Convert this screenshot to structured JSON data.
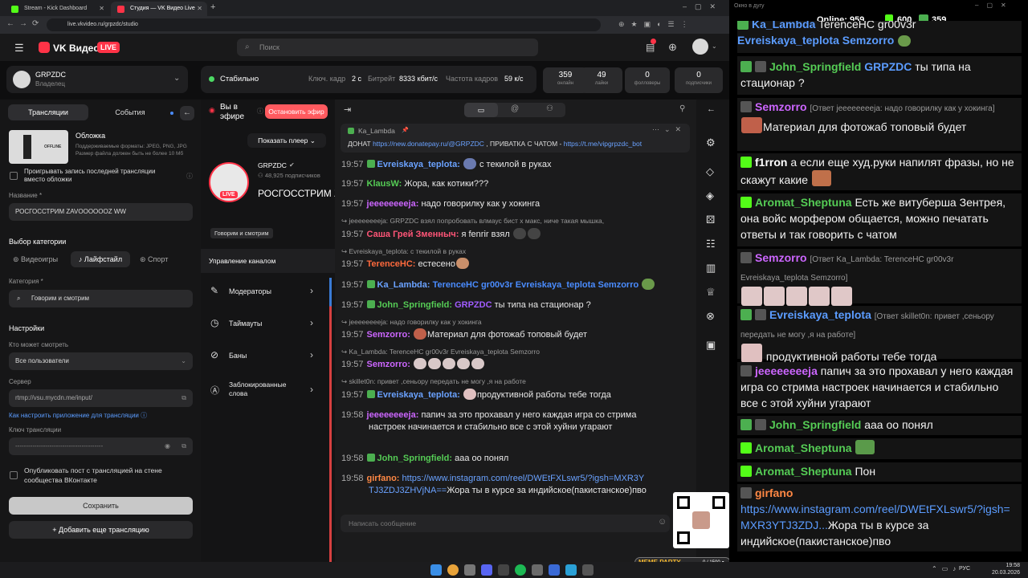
{
  "browser": {
    "tabs": [
      {
        "label": "Stream - Kick Dashboard",
        "color": "#53fc18"
      },
      {
        "label": "Студия — VK Видео Live",
        "color": "#ff3347"
      }
    ],
    "new_tab": "+",
    "url": "live.vkvideo.ru/grpzdc/studio"
  },
  "vk": {
    "logo": "VK Видео",
    "live_badge": "LIVE",
    "search_placeholder": "Поиск",
    "channel": {
      "name": "GRPZDC",
      "role": "Владелец"
    },
    "status": {
      "label": "Стабильно",
      "keyframe_label": "Ключ. кадр",
      "keyframe_value": "2 с",
      "bitrate_label": "Битрейт",
      "bitrate_value": "8333 кбит/с",
      "fps_label": "Частота кадров",
      "fps_value": "59 к/с"
    },
    "stats": [
      {
        "n": "359",
        "l": "онлайн"
      },
      {
        "n": "49",
        "l": "лайки"
      },
      {
        "n": "0",
        "l": "фолловеры"
      },
      {
        "n": "0",
        "l": "подписчики"
      }
    ],
    "left_tabs": [
      "Трансляции",
      "События"
    ],
    "cover": {
      "title": "Обложка",
      "desc": "Поддерживаемые форматы: JPEG, PNG, JPG Размер файла должен быть не более 10 Мб",
      "thumb_label": "OFFLINE"
    },
    "play_last": "Проигрывать запись последней трансляции вместо обложки",
    "name_label": "Название *",
    "name_value": "РОСГОССТРИМ ZAVOOOOOOZ WW",
    "category_label": "Выбор категории",
    "category_tabs": [
      "Видеоигры",
      "Лайфстайл",
      "Спорт"
    ],
    "cat_field_label": "Категория *",
    "cat_field_value": "Говорим и смотрим",
    "settings": "Настройки",
    "who_label": "Кто может смотреть",
    "who_value": "Все пользователи",
    "server_label": "Сервер",
    "server_value": "rtmp://vsu.mycdn.me/input/",
    "howto": "Как настроить приложение для трансляции",
    "key_label": "Ключ трансляции",
    "key_value": "-----------------------------------------",
    "publish": "Опубликовать пост с трансляцией на стене сообщества ВКонтакте",
    "save": "Сохранить",
    "add": "Добавить еще трансляцию",
    "onair": "Вы в эфире",
    "stop": "Остановить эфир",
    "show_player": "Показать плеер",
    "streamer": {
      "name": "GRPZDC",
      "subs": "48,925 подписчиков",
      "title": "РОСГОССТРИМ ZAVOOOOOOZ WW",
      "tag": "Говорим и смотрим"
    },
    "manage": "Управление каналом",
    "menu": [
      "Модераторы",
      "Таймауты",
      "Баны",
      "Заблокированные слова"
    ],
    "pinned": {
      "author": "Ka_Lambda",
      "text1": "ДОНАТ ",
      "link1": "https://new.donatepay.ru/@GRPZDC",
      "text2": " , ПРИВАТКА С ЧАТОМ - ",
      "link2": "https://t.me/vipgrpzdc_bot"
    },
    "chat_input": "Написать сообщение"
  },
  "mid_chat": [
    {
      "time": "19:57",
      "user": "Evreiskaya_teplota:",
      "uc": "#6aa2ff",
      "badge": "#4caf50",
      "text": "с текилой в руках"
    },
    {
      "time": "19:57",
      "user": "KlausW:",
      "uc": "#55cc55",
      "text": "Жора, как котики???"
    },
    {
      "time": "19:57",
      "user": "jeeeeeeeeja:",
      "uc": "#cc66ff",
      "text": "надо говорилку как у хокинга"
    },
    {
      "reply": "↪ jeeeeeeeeja: GRPZDC взял попробовать влмаус бист х макс, ниче такая мышка,"
    },
    {
      "time": "19:57",
      "user": "Саша Грей Зменныч:",
      "uc": "#ff5577",
      "text": "я fenrir взял"
    },
    {
      "reply": "↪ Evreiskaya_teplota: с текилой в руках"
    },
    {
      "time": "19:57",
      "user": "TerenceHC:",
      "uc": "#ff6a3d",
      "text": "естесено"
    },
    {
      "time": "19:57",
      "user": "Ka_Lambda:",
      "uc": "#6aa2ff",
      "badge": "#4caf50",
      "mention": "TerenceHC gr00v3r Evreiskaya_teplota Semzorro",
      "mc": "#4a8cff"
    },
    {
      "time": "19:57",
      "user": "John_Springfield:",
      "uc": "#55cc55",
      "badge": "#4caf50",
      "mention": "GRPZDC",
      "mc": "#a15cff",
      "text": "ты типа на стационар ?"
    },
    {
      "reply": "↪ jeeeeeeeeja: надо говорилку как у хокинга"
    },
    {
      "time": "19:57",
      "user": "Semzorro:",
      "uc": "#cc66ff",
      "text": "Материал для фотожаб топовый будет"
    },
    {
      "reply": "↪ Ka_Lambda: TerenceHC gr00v3r Evreiskaya_teplota Semzorro"
    },
    {
      "time": "19:57",
      "user": "Semzorro:",
      "uc": "#cc66ff",
      "text": ""
    },
    {
      "reply": "↪ skillet0n: привет ,сеньору передать не могу ,я на работе"
    },
    {
      "time": "19:57",
      "user": "Evreiskaya_teplota:",
      "uc": "#6aa2ff",
      "badge": "#4caf50",
      "text": "продуктивной работы тебе тогда"
    },
    {
      "time": "19:58",
      "user": "jeeeeeeeeja:",
      "uc": "#cc66ff",
      "text": "папич за это прохавал у него каждая игра со стрима настроек начинается и стабильно все с этой хуйни угарают"
    },
    {
      "time": "19:58",
      "user": "John_Springfield:",
      "uc": "#55cc55",
      "badge": "#4caf50",
      "text": "ааа оо понял"
    },
    {
      "time": "19:58",
      "user": "girfano:",
      "uc": "#ff8844",
      "link": "https://www.instagram.com/reel/DWEtFXLswr5/?igsh=MXR3YTJ3ZDJ3ZHVjNA==",
      "text": "Жора ты в курсе за индийское(пакистанское)пво"
    }
  ],
  "overlay": {
    "online_label": "Online:",
    "online": "959",
    "kick": "600",
    "vk": "359",
    "window_title": "Окно в дугу",
    "meme_label": "MEME PARTY",
    "meme_count": "0 / 1500 ●"
  },
  "right_chat": [
    {
      "user": "Ka_Lambda",
      "text": "TerenceHC gr00v3r"
    },
    {
      "user": "Evreiskaya_teplota Semzorro",
      "text": ""
    },
    {
      "user": "John_Springfield",
      "mention": "GRPZDC",
      "text": "ты типа на стационар ?"
    },
    {
      "user": "Semzorro",
      "reply": "[Ответ jeeeeeeeeja: надо говорилку как у хокинга]",
      "text": "Материал для фотожаб топовый будет"
    },
    {
      "user": "f1rron",
      "text": "а если еще худ.руки напилят фразы, но не скажут какие"
    },
    {
      "user": "Aromat_Sheptuna",
      "text": "Есть же витуберша Зентрея, она войс морфером общается, можно печатать ответы и так говорить с чатом"
    },
    {
      "user": "Semzorro",
      "reply": "[Ответ Ka_Lambda: TerenceHC gr00v3r Evreiskaya_teplota Semzorro]",
      "text": ""
    },
    {
      "user": "Evreiskaya_teplota",
      "reply": "[Ответ skillet0n: привет ,сеньору передать не могу ,я на работе]",
      "text": "продуктивной работы тебе тогда"
    },
    {
      "user": "jeeeeeeeeja",
      "text": "папич за это прохавал у него каждая игра со стрима настроек начинается и стабильно все с этой хуйни угарают"
    },
    {
      "user": "John_Springfield",
      "text": "ааа оо понял"
    },
    {
      "user": "Aromat_Sheptuna",
      "text": ""
    },
    {
      "user": "Aromat_Sheptuna",
      "text": "Пон"
    },
    {
      "user": "girfano",
      "link": "https://www.instagram.com/reel/DWEtFXLswr5/?igsh=MXR3YTJ3ZDJ...",
      "text": "Жора ты в курсе за индийское(пакистанское)пво"
    }
  ],
  "taskbar": {
    "lang": "РУС",
    "time": "19:58",
    "date": "20.03.2026"
  }
}
